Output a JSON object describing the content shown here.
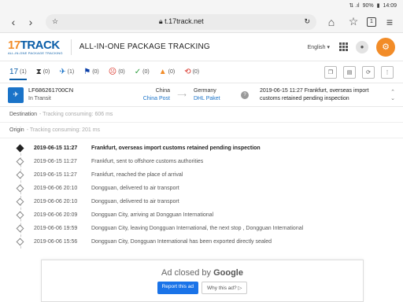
{
  "status_bar": {
    "battery": "90%",
    "time": "14:09"
  },
  "browser": {
    "url": "t.17track.net",
    "tab_count": "1"
  },
  "header": {
    "logo_main_a": "17",
    "logo_main_b": "TRACK",
    "logo_sub": "ALL-IN-ONE PACKAGE TRACKING",
    "title": "ALL-IN-ONE PACKAGE TRACKING",
    "language": "English"
  },
  "filters": [
    {
      "icon": "17",
      "count": "(1)"
    },
    {
      "icon": "⧗",
      "count": "(0)"
    },
    {
      "icon": "✈",
      "count": "(1)"
    },
    {
      "icon": "⚑",
      "count": "(0)"
    },
    {
      "icon": "☹",
      "count": "(0)"
    },
    {
      "icon": "✓",
      "count": "(0)"
    },
    {
      "icon": "▲",
      "count": "(0)"
    },
    {
      "icon": "⟲",
      "count": "(0)"
    }
  ],
  "package": {
    "tracking_number": "LF686261700CN",
    "status": "In Transit",
    "origin_country": "China",
    "origin_carrier": "China Post",
    "dest_country": "Germany",
    "dest_carrier": "DHL Paket",
    "latest_event": "2019-06-15 11:27  Frankfurt, overseas import customs retained pending inspection"
  },
  "destination": {
    "label": "Destination",
    "sub": "- Tracking consuming: 606 ms"
  },
  "origin": {
    "label": "Origin",
    "sub": "- Tracking consuming: 201 ms"
  },
  "events": [
    {
      "time": "2019-06-15 11:27",
      "desc": "Frankfurt, overseas import customs retained pending inspection"
    },
    {
      "time": "2019-06-15 11:27",
      "desc": "Frankfurt, sent to offshore customs authorities"
    },
    {
      "time": "2019-06-15 11:27",
      "desc": "Frankfurt, reached the place of arrival"
    },
    {
      "time": "2019-06-06 20:10",
      "desc": "Dongguan, delivered to air transport"
    },
    {
      "time": "2019-06-06 20:10",
      "desc": "Dongguan, delivered to air transport"
    },
    {
      "time": "2019-06-06 20:09",
      "desc": "Dongguan City, arriving at Dongguan International"
    },
    {
      "time": "2019-06-06 19:59",
      "desc": "Dongguan City, leaving Dongguan International, the next stop , Dongguan International"
    },
    {
      "time": "2019-06-06 15:56",
      "desc": "Dongguan City, Dongguan International has been exported directly sealed"
    }
  ],
  "ad": {
    "closed_text": "Ad closed by",
    "google": "Google",
    "report_label": "Report this ad",
    "why_label": "Why this ad? ▷"
  }
}
